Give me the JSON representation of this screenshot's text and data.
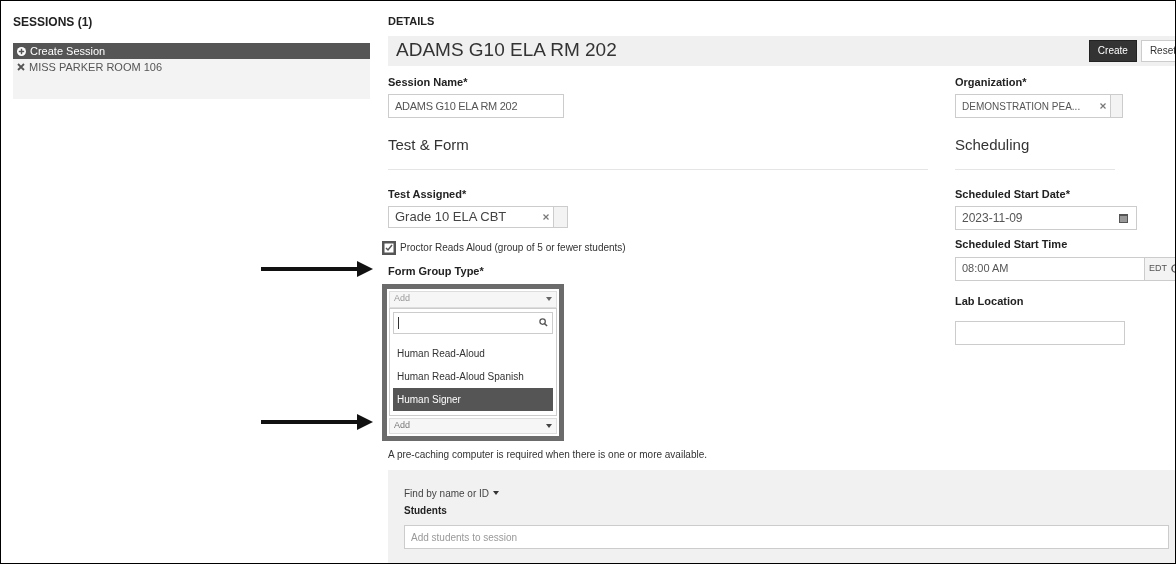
{
  "sessions": {
    "title": "SESSIONS (1)",
    "items": [
      {
        "kind": "add",
        "label": "Create Session",
        "selected": true
      },
      {
        "kind": "remove",
        "label": "MISS PARKER ROOM 106",
        "selected": false
      }
    ]
  },
  "details": {
    "heading": "DETAILS",
    "title": "ADAMS G10 ELA RM 202",
    "buttons": [
      {
        "kind": "primary",
        "label": "Create"
      },
      {
        "kind": "default",
        "label": "Reset"
      }
    ],
    "session_name": {
      "label": "Session Name*",
      "value": "ADAMS  G10 ELA RM 202"
    },
    "organization": {
      "label": "Organization*",
      "value": "DEMONSTRATION PEA..."
    },
    "test_form_heading": "Test & Form",
    "scheduling_heading": "Scheduling",
    "test_assigned": {
      "label": "Test Assigned*",
      "value": "Grade 10 ELA CBT"
    },
    "proctor_reads_aloud": {
      "label": "Proctor Reads Aloud (group of 5 or fewer students)",
      "checked": true
    },
    "form_group_type": {
      "label": "Form Group Type*",
      "placeholder": "Add",
      "second_placeholder": "Add",
      "options": [
        {
          "label": "Human Read-Aloud",
          "selected": false
        },
        {
          "label": "Human Read-Aloud Spanish",
          "selected": false
        },
        {
          "label": "Human Signer",
          "selected": true
        }
      ]
    },
    "start_date": {
      "label": "Scheduled Start Date*",
      "value": "2023-11-09"
    },
    "start_time": {
      "label": "Scheduled Start Time",
      "value": "08:00 AM",
      "zone": "EDT"
    },
    "lab_location": {
      "label": "Lab Location"
    },
    "note": "A pre-caching computer is required when there is one or more available.",
    "students": {
      "finder": "Find by name or ID",
      "label": "Students",
      "placeholder": "Add students to session"
    }
  }
}
